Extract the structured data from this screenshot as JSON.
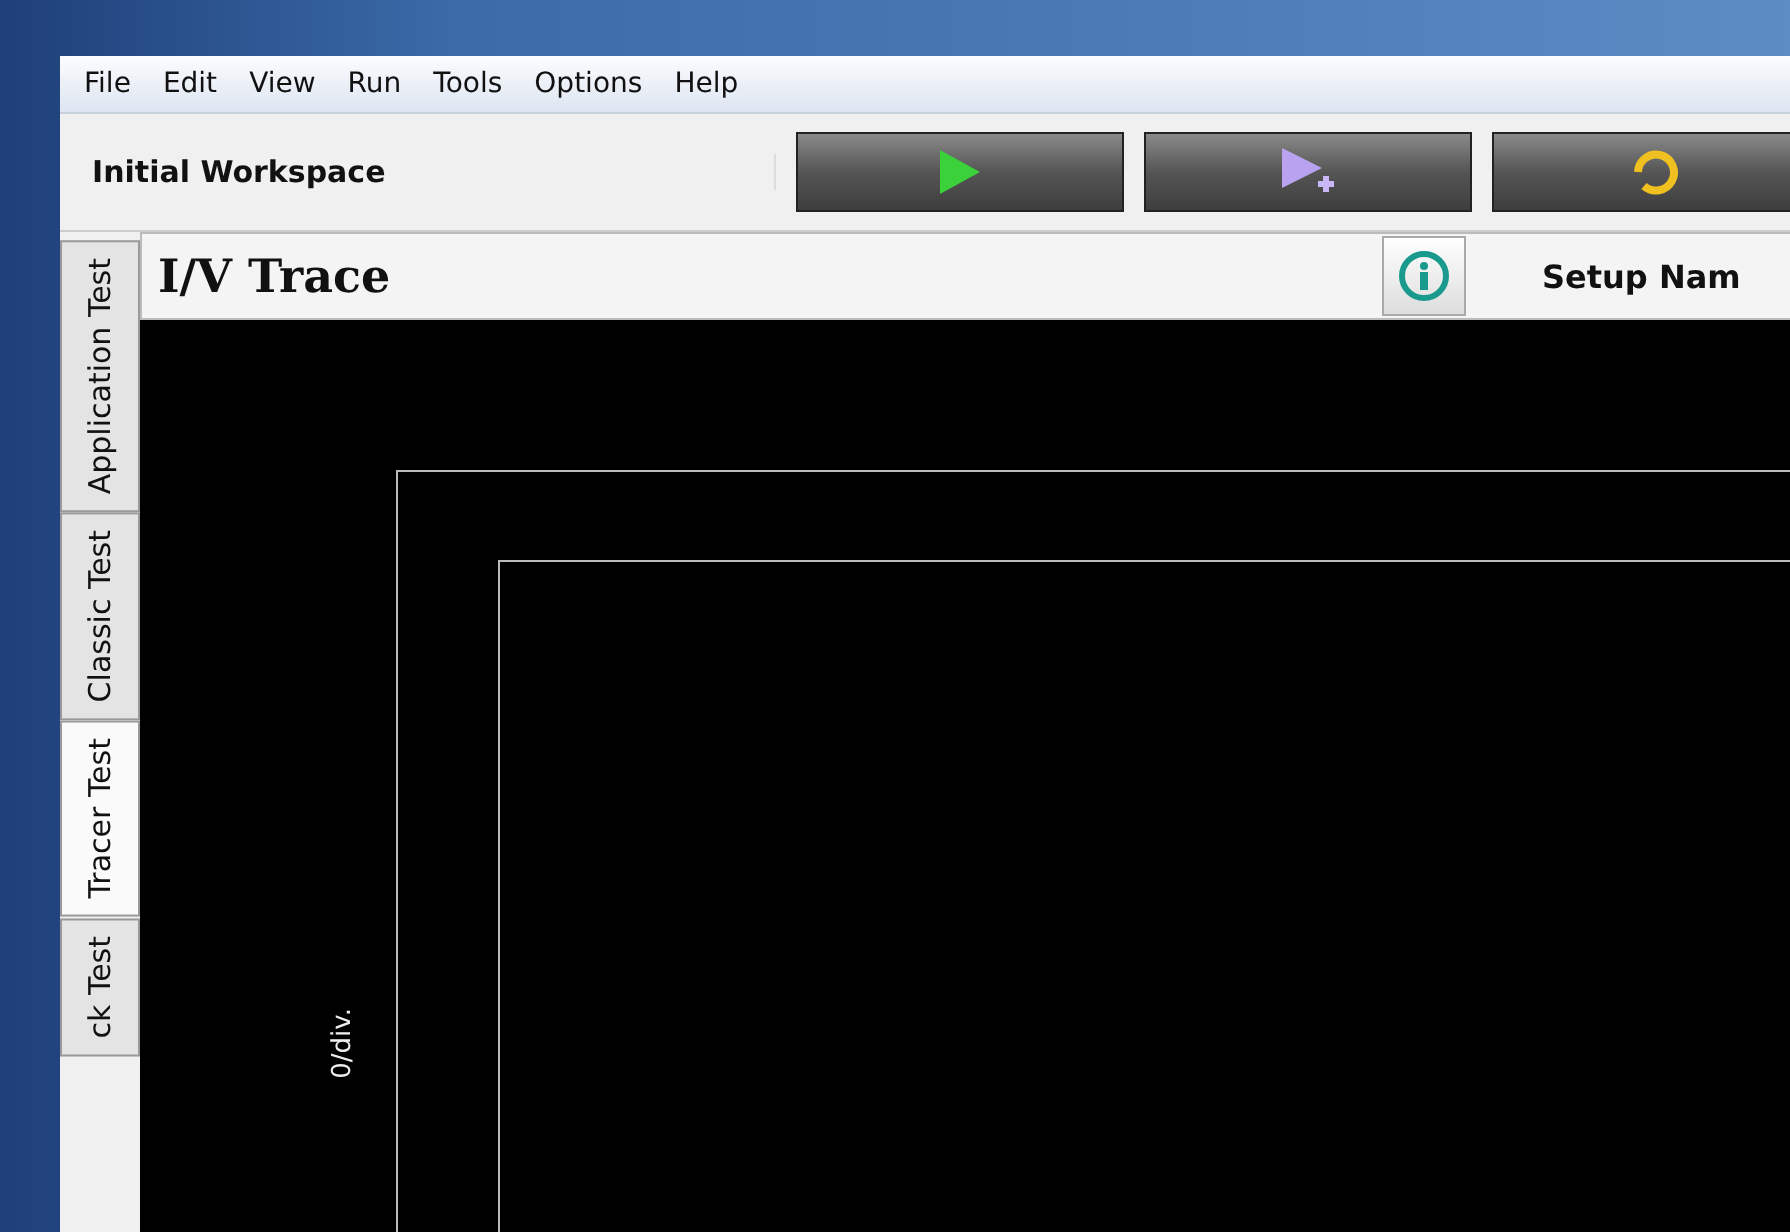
{
  "menu": [
    "File",
    "Edit",
    "View",
    "Run",
    "Tools",
    "Options",
    "Help"
  ],
  "workspace": {
    "title": "Initial Workspace"
  },
  "toolbar_buttons": [
    {
      "kind": "run"
    },
    {
      "kind": "run-add"
    },
    {
      "kind": "refresh"
    }
  ],
  "side_tabs": [
    {
      "label": "Application Test",
      "selected": false
    },
    {
      "label": "Classic Test",
      "selected": false
    },
    {
      "label": "Tracer Test",
      "selected": true
    },
    {
      "label": "ck Test",
      "selected": false
    }
  ],
  "panel": {
    "title": "I/V Trace",
    "setup_label": "Setup Nam",
    "y_axis_label": "0/div."
  }
}
